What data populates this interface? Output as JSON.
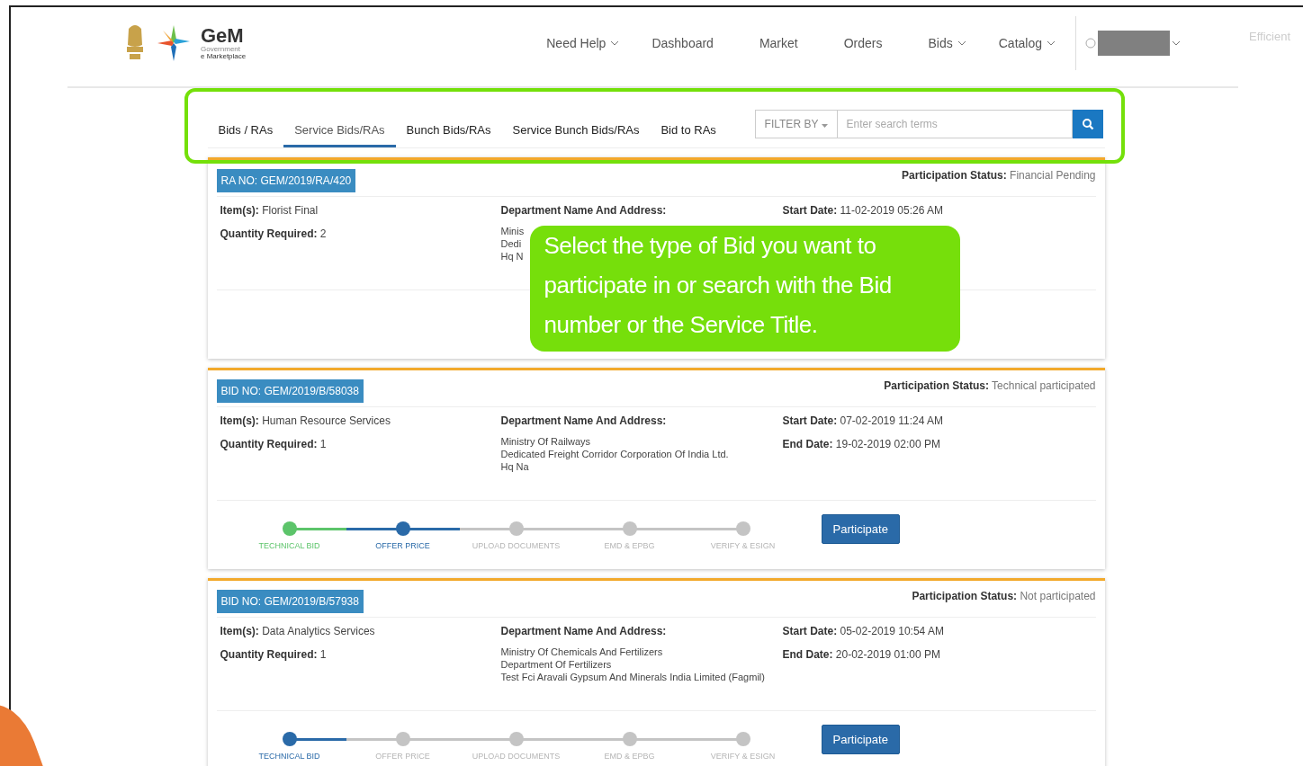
{
  "side_text": "Efficient",
  "header": {
    "logo_title": "GeM",
    "logo_subtitle_1": "Government",
    "logo_subtitle_2": "e Marketplace",
    "nav": [
      {
        "label": "Need Help",
        "dropdown": true
      },
      {
        "label": "Dashboard",
        "dropdown": false
      },
      {
        "label": "Market",
        "dropdown": false
      },
      {
        "label": "Orders",
        "dropdown": false
      },
      {
        "label": "Bids",
        "dropdown": true
      },
      {
        "label": "Catalog",
        "dropdown": true
      }
    ]
  },
  "tabs": [
    {
      "label": "Bids / RAs",
      "selected": false
    },
    {
      "label": "Service Bids/RAs",
      "selected": true
    },
    {
      "label": "Bunch Bids/RAs",
      "selected": false
    },
    {
      "label": "Service Bunch Bids/RAs",
      "selected": false
    },
    {
      "label": "Bid to RAs",
      "selected": false
    }
  ],
  "filter": {
    "label": "FILTER BY"
  },
  "search": {
    "placeholder": "Enter search terms"
  },
  "callout": "Select the type of Bid you want to participate in or search with the Bid number or the Service Title.",
  "cards": [
    {
      "number": "RA NO: GEM/2019/RA/420",
      "status_label": "Participation Status:",
      "status": "Financial Pending",
      "items_label": "Item(s):",
      "items": "Florist Final",
      "qty_label": "Quantity Required:",
      "qty": "2",
      "dept_label": "Department Name And Address:",
      "address": [
        "Minis",
        "Dedi",
        "Hq N"
      ],
      "start_label": "Start Date:",
      "start": "11-02-2019 05:26 AM"
    },
    {
      "number": "BID NO: GEM/2019/B/58038",
      "status_label": "Participation Status:",
      "status": "Technical participated",
      "items_label": "Item(s):",
      "items": "Human Resource Services",
      "qty_label": "Quantity Required:",
      "qty": "1",
      "dept_label": "Department Name And Address:",
      "address": [
        "Ministry Of Railways",
        "Dedicated Freight Corridor Corporation Of India Ltd.",
        "Hq Na"
      ],
      "start_label": "Start Date:",
      "start": "07-02-2019 11:24 AM",
      "end_label": "End Date:",
      "end": "19-02-2019 02:00 PM",
      "steps": [
        {
          "label": "TECHNICAL BID",
          "completed": true,
          "active": false
        },
        {
          "label": "OFFER PRICE",
          "completed": false,
          "active": true
        },
        {
          "label": "UPLOAD DOCUMENTS",
          "completed": false,
          "active": false
        },
        {
          "label": "EMD & EPBG",
          "completed": false,
          "active": false
        },
        {
          "label": "VERIFY & ESIGN",
          "completed": false,
          "active": false
        }
      ],
      "button": "Participate"
    },
    {
      "number": "BID NO: GEM/2019/B/57938",
      "status_label": "Participation Status:",
      "status": "Not participated",
      "items_label": "Item(s):",
      "items": "Data Analytics Services",
      "qty_label": "Quantity Required:",
      "qty": "1",
      "dept_label": "Department Name And Address:",
      "address": [
        "Ministry Of Chemicals And Fertilizers",
        "Department Of Fertilizers",
        "Test Fci Aravali Gypsum And Minerals India Limited (Fagmil)"
      ],
      "start_label": "Start Date:",
      "start": "05-02-2019 10:54 AM",
      "end_label": "End Date:",
      "end": "20-02-2019 01:00 PM",
      "steps": [
        {
          "label": "TECHNICAL BID",
          "completed": false,
          "active": true
        },
        {
          "label": "OFFER PRICE",
          "completed": false,
          "active": false
        },
        {
          "label": "UPLOAD DOCUMENTS",
          "completed": false,
          "active": false
        },
        {
          "label": "EMD & EPBG",
          "completed": false,
          "active": false
        },
        {
          "label": "VERIFY & ESIGN",
          "completed": false,
          "active": false
        }
      ],
      "button": "Participate"
    }
  ]
}
